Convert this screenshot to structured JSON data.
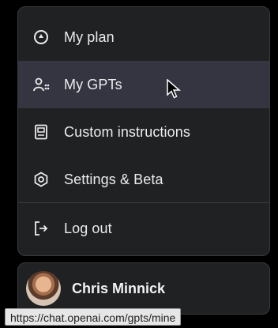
{
  "menu": {
    "items": [
      {
        "label": "My plan",
        "icon": "plan-icon"
      },
      {
        "label": "My GPTs",
        "icon": "gpts-icon"
      },
      {
        "label": "Custom instructions",
        "icon": "instructions-icon"
      },
      {
        "label": "Settings & Beta",
        "icon": "settings-icon"
      },
      {
        "label": "Log out",
        "icon": "logout-icon"
      }
    ]
  },
  "profile": {
    "name": "Chris Minnick"
  },
  "status_bar": {
    "url": "https://chat.openai.com/gpts/mine"
  },
  "colors": {
    "menu_bg": "#202123",
    "hover_bg": "#343541",
    "text": "#ececec"
  }
}
